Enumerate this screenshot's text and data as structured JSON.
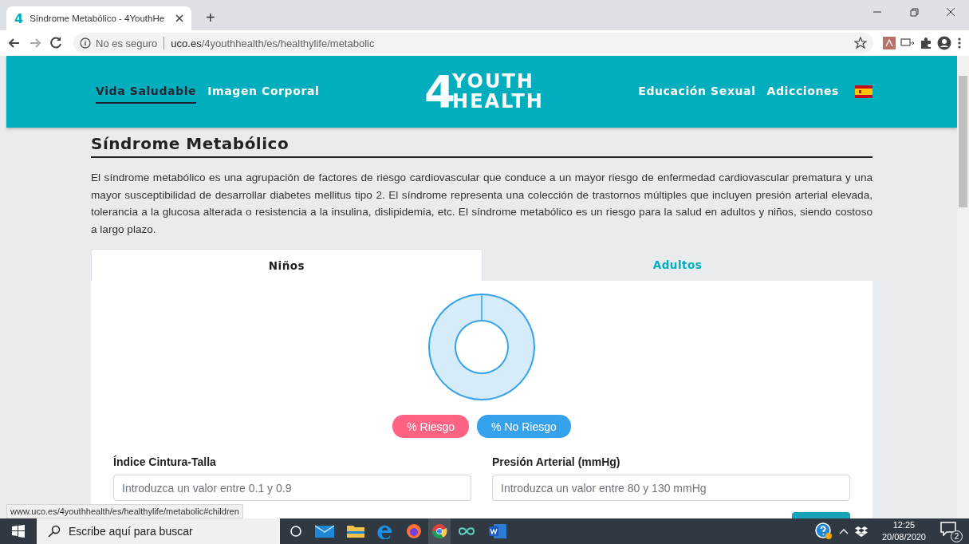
{
  "browser": {
    "favicon": "4",
    "tab_title": "Síndrome Metabólico - 4YouthHe",
    "new_tab": "+",
    "security": "No es seguro",
    "url_host": "uco.es",
    "url_path": "/4youthhealth/es/healthylife/metabolic"
  },
  "header": {
    "nav_left": [
      {
        "label": "Vida Saludable",
        "selected": true
      },
      {
        "label": "Imagen Corporal",
        "selected": false
      }
    ],
    "logo": {
      "mark": "4",
      "top": "YOUTH",
      "bottom": "HEALTH"
    },
    "nav_right": [
      {
        "label": "Educación Sexual",
        "selected": false
      },
      {
        "label": "Adicciones",
        "selected": false
      }
    ]
  },
  "content": {
    "title": "Síndrome Metabólico",
    "paragraph": "El síndrome metabólico es una agrupación de factores de riesgo cardiovascular que conduce a un mayor riesgo de enfermedad cardiovascular prematura y una mayor susceptibilidad de desarrollar diabetes mellitus tipo 2. El síndrome representa una colección de trastornos múltiples que incluyen presión arterial elevada, tolerancia a la glucosa alterada o resistencia a la insulina, dislipidemia, etc. El síndrome metabólico es un riesgo para la salud en adultos y niños, siendo costoso a largo plazo.",
    "tabs": [
      {
        "label": "Niños",
        "selected": true
      },
      {
        "label": "Adultos",
        "selected": false
      }
    ],
    "legend": [
      {
        "label": "% Riesgo",
        "color": "#ff6384"
      },
      {
        "label": "% No Riesgo",
        "color": "#36a2eb"
      }
    ],
    "fields": [
      {
        "label": "Índice Cintura-Talla",
        "placeholder": "Introduzca un valor entre 0.1 y 0.9"
      },
      {
        "label": "Presión Arterial (mmHg)",
        "placeholder": "Introduzca un valor entre 80 y 130 mmHg"
      }
    ]
  },
  "status_url": "www.uco.es/4youthhealth/es/healthylife/metabolic#children",
  "taskbar": {
    "search_placeholder": "Escribe aquí para buscar",
    "time": "12:25",
    "date": "20/08/2020",
    "notifications": "2"
  }
}
